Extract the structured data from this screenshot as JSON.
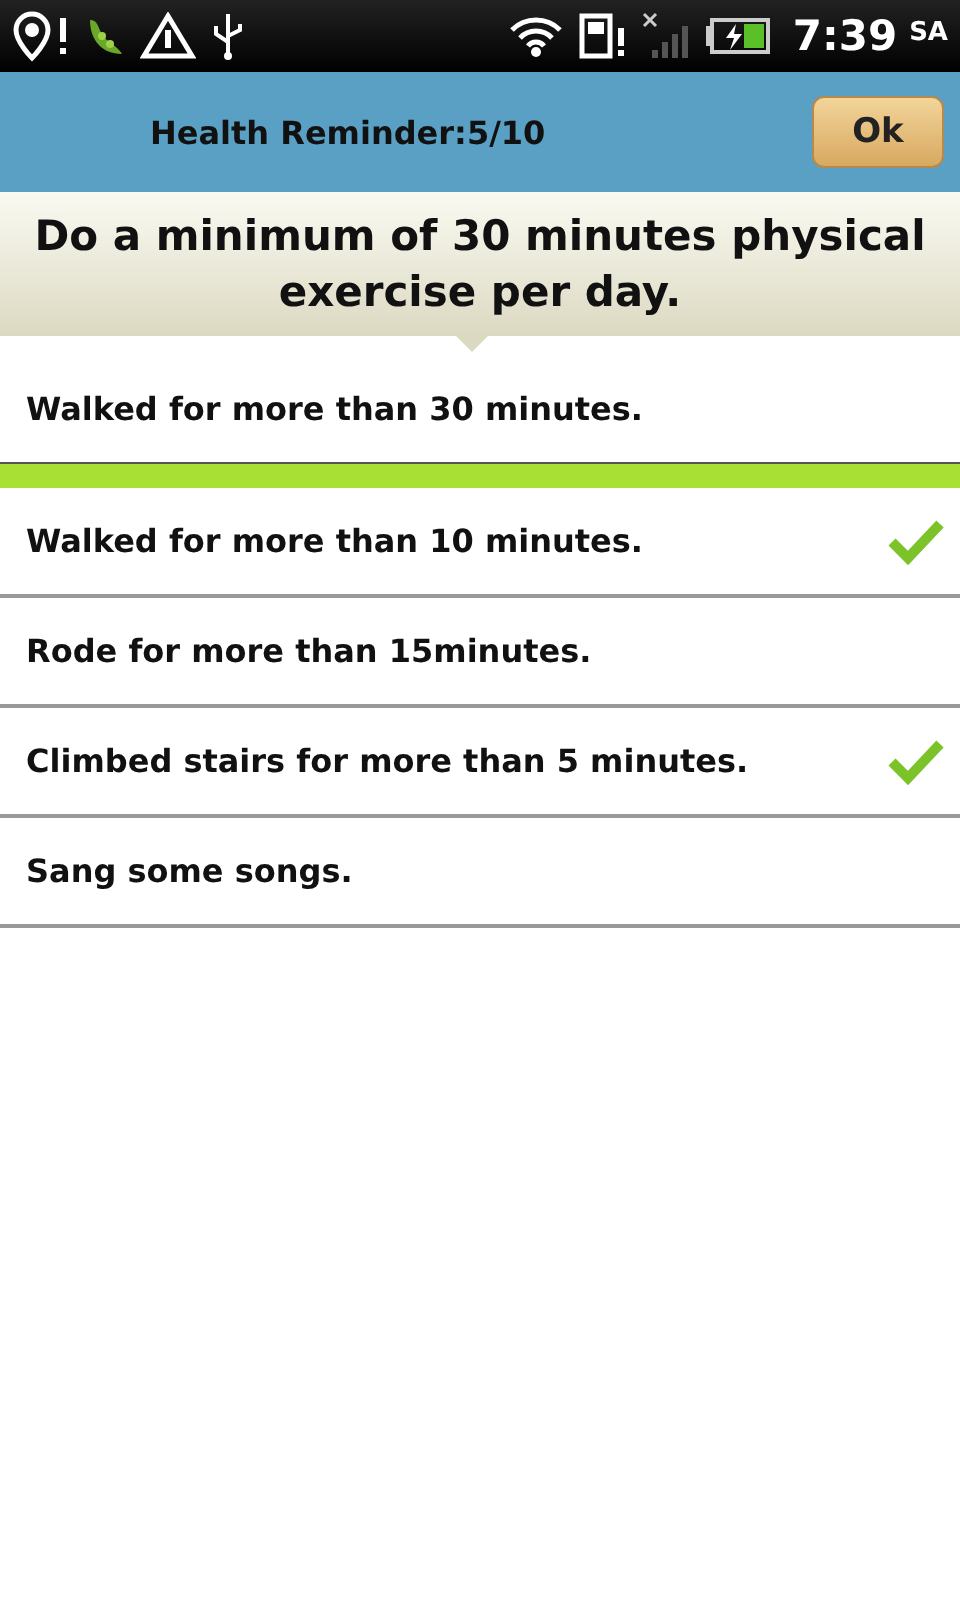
{
  "status_bar": {
    "time": "7:39",
    "period": "SA"
  },
  "header": {
    "title": "Health Reminder:5/10",
    "ok_button": "Ok"
  },
  "banner": {
    "text": "Do a minimum of 30 minutes physical exercise per day."
  },
  "items": [
    {
      "label": "Walked for more than 30 minutes.",
      "checked": false
    },
    {
      "label": "Walked for more than 10 minutes.",
      "checked": true
    },
    {
      "label": "Rode for more than 15minutes.",
      "checked": false
    },
    {
      "label": "Climbed stairs for more than 5 minutes.",
      "checked": true
    },
    {
      "label": "Sang some songs.",
      "checked": false
    }
  ]
}
